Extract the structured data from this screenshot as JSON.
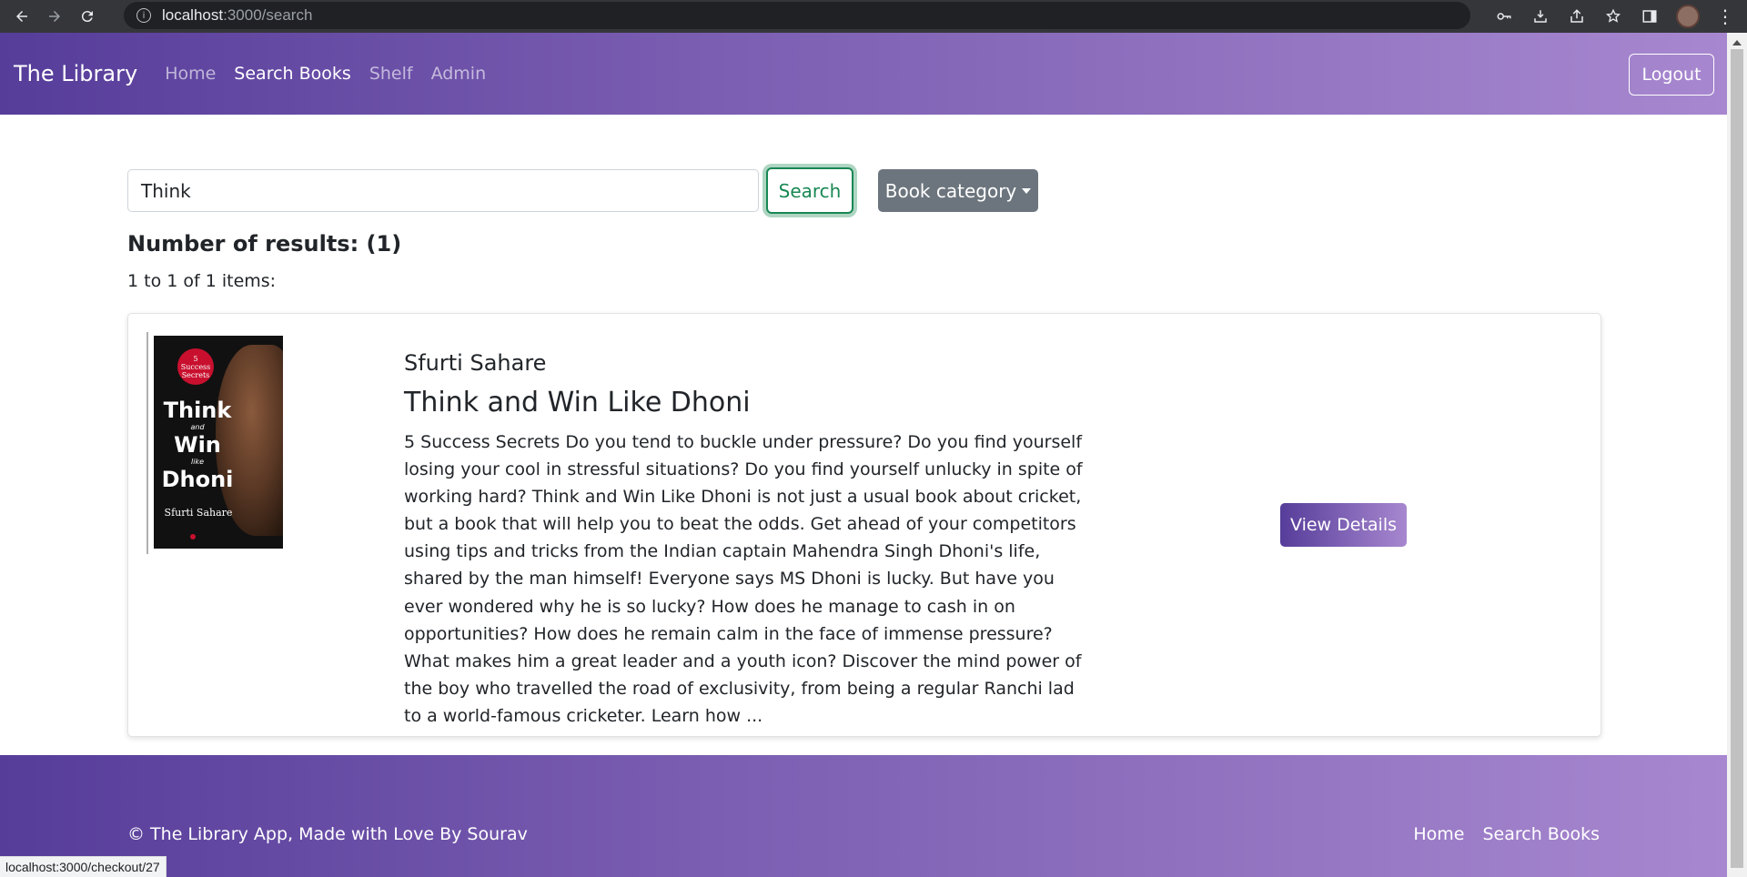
{
  "browser": {
    "url_host": "localhost",
    "url_path": ":3000/search",
    "status_url": "localhost:3000/checkout/27"
  },
  "navbar": {
    "brand": "The Library",
    "links": [
      {
        "label": "Home",
        "active": false
      },
      {
        "label": "Search Books",
        "active": true
      },
      {
        "label": "Shelf",
        "active": false
      },
      {
        "label": "Admin",
        "active": false
      }
    ],
    "logout_label": "Logout"
  },
  "search": {
    "value": "Think",
    "button_label": "Search",
    "category_label": "Book category"
  },
  "results": {
    "heading": "Number of results: (1)",
    "range": "1 to 1 of 1 items:"
  },
  "book": {
    "author": "Sfurti Sahare",
    "title": "Think and Win Like Dhoni",
    "description": "5 Success Secrets Do you tend to buckle under pressure? Do you find yourself losing your cool in stressful situations? Do you find yourself unlucky in spite of working hard? Think and Win Like Dhoni is not just a usual book about cricket, but a book that will help you to beat the odds. Get ahead of your competitors using tips and tricks from the Indian captain Mahendra Singh Dhoni's life, shared by the man himself! Everyone says MS Dhoni is lucky. But have you ever wondered why he is so lucky? How does he manage to cash in on opportunities? How does he remain calm in the face of immense pressure? What makes him a great leader and a youth icon? Discover the mind power of the boy who travelled the road of exclusivity, from being a regular Ranchi lad to a world-famous cricketer. Learn how ...",
    "view_label": "View Details",
    "cover": {
      "badge_line1": "5",
      "badge_line2": "Success",
      "badge_line3": "Secrets",
      "word1": "Think",
      "word2": "and",
      "word3": "Win",
      "word4": "like",
      "word5": "Dhoni",
      "author": "Sfurti Sahare"
    }
  },
  "footer": {
    "copyright": "© The Library App, Made with Love By Sourav",
    "links": [
      "Home",
      "Search Books"
    ]
  },
  "colors": {
    "gradient_start": "#563d9a",
    "gradient_end": "#a787cf",
    "success": "#198754",
    "secondary": "#6c757d"
  }
}
